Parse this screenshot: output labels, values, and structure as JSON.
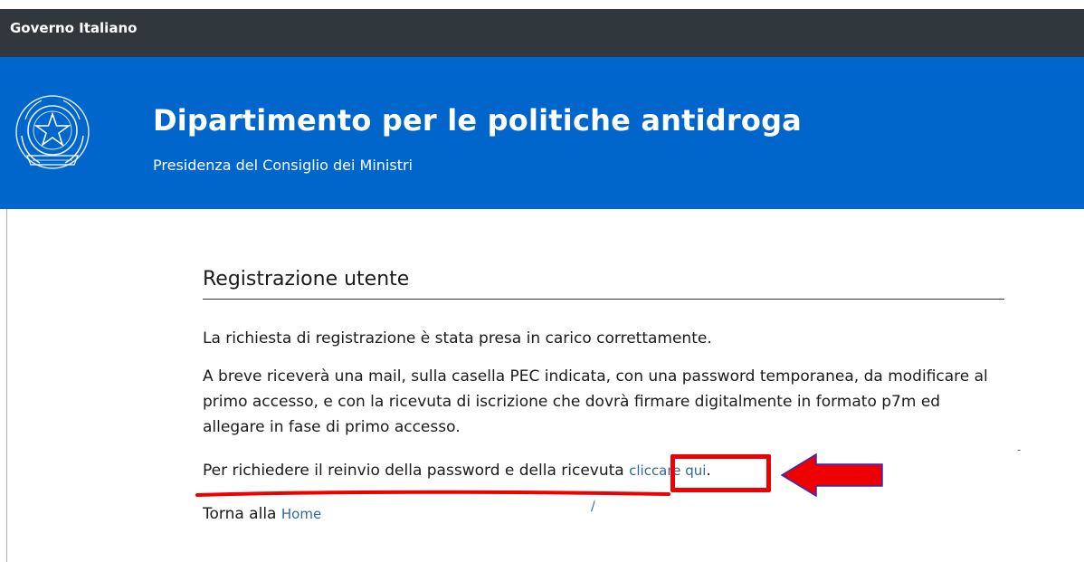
{
  "topbar": {
    "government_link": "Governo Italiano"
  },
  "header": {
    "title": "Dipartimento per le politiche antidroga",
    "subtitle": "Presidenza del Consiglio dei Ministri",
    "emblem_icon": "repubblica-italiana-emblem-icon"
  },
  "main": {
    "heading": "Registrazione utente",
    "paragraph1": "La richiesta di registrazione è stata presa in carico correttamente.",
    "paragraph2": "A breve riceverà una mail, sulla casella PEC indicata, con una password temporanea, da modificare al primo accesso, e con la ricevuta di iscrizione che dovrà firmare digitalmente in formato p7m ed allegare in fase di primo accesso.",
    "resend_text": "Per richiedere il reinvio della password e della ricevuta ",
    "resend_link": "cliccare qui",
    "resend_suffix": ".",
    "back_text": "Torna alla ",
    "back_link": "Home"
  },
  "annotations": {
    "highlight_color": "#ee0000",
    "arrow_icon": "left-arrow-icon"
  },
  "colors": {
    "topbar": "#30373d",
    "header": "#0066cc",
    "link": "#3068a6"
  }
}
